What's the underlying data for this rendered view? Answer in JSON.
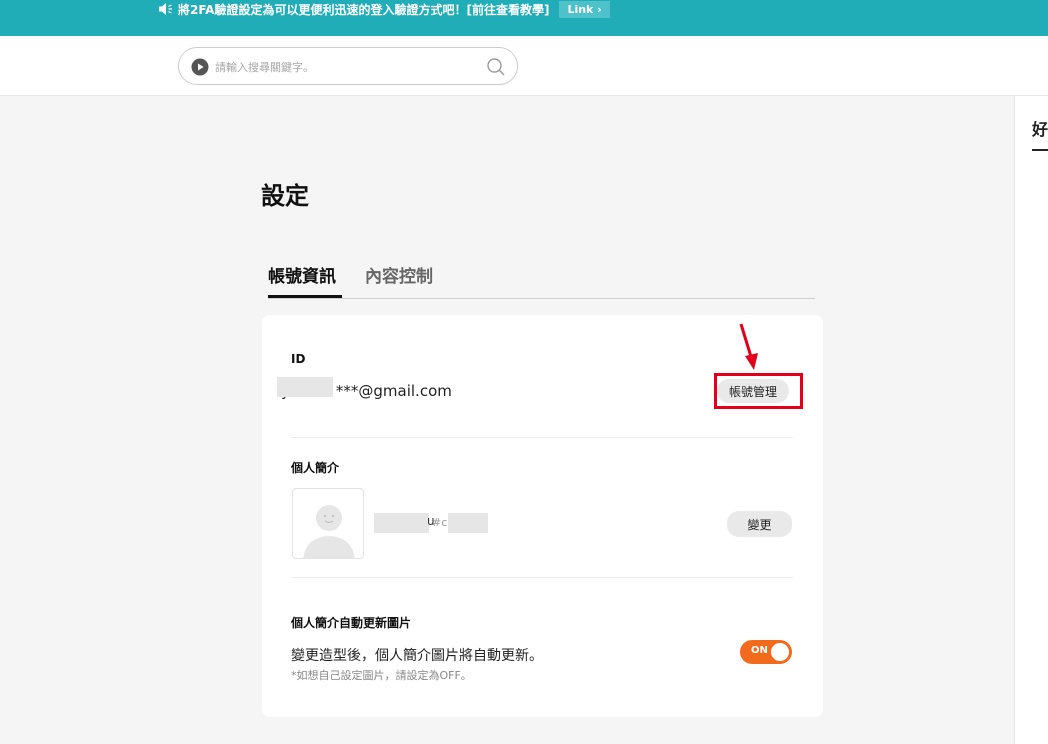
{
  "banner": {
    "text": "將2FA驗證設定為可以更便利迅速的登入驗證方式吧！[前往查看教學]",
    "link_label": "Link",
    "link_chevron": "›",
    "icon": "speaker-icon"
  },
  "search": {
    "placeholder": "請輸入搜尋關鍵字。",
    "icons": [
      "play-icon",
      "search-icon"
    ]
  },
  "right_panel": {
    "partial_text": "好"
  },
  "page": {
    "title": "設定"
  },
  "tabs": [
    {
      "label": "帳號資訊",
      "active": true
    },
    {
      "label": "內容控制",
      "active": false
    }
  ],
  "id_section": {
    "label": "ID",
    "email_prefix": "y",
    "email_visible": "***@gmail.com",
    "manage_button": "帳號管理"
  },
  "profile_section": {
    "label": "個人簡介",
    "nickname_suffix": "u",
    "hash_prefix": "#c",
    "change_button": "變更"
  },
  "auto_update_section": {
    "label": "個人簡介自動更新圖片",
    "description": "變更造型後，個人簡介圖片將自動更新。",
    "note": "*如想自己設定圖片，請設定為OFF。",
    "toggle_label": "ON",
    "toggle_on": true
  },
  "colors": {
    "banner": "#21adb8",
    "toggle": "#f26b1d",
    "highlight": "#e3001b"
  }
}
